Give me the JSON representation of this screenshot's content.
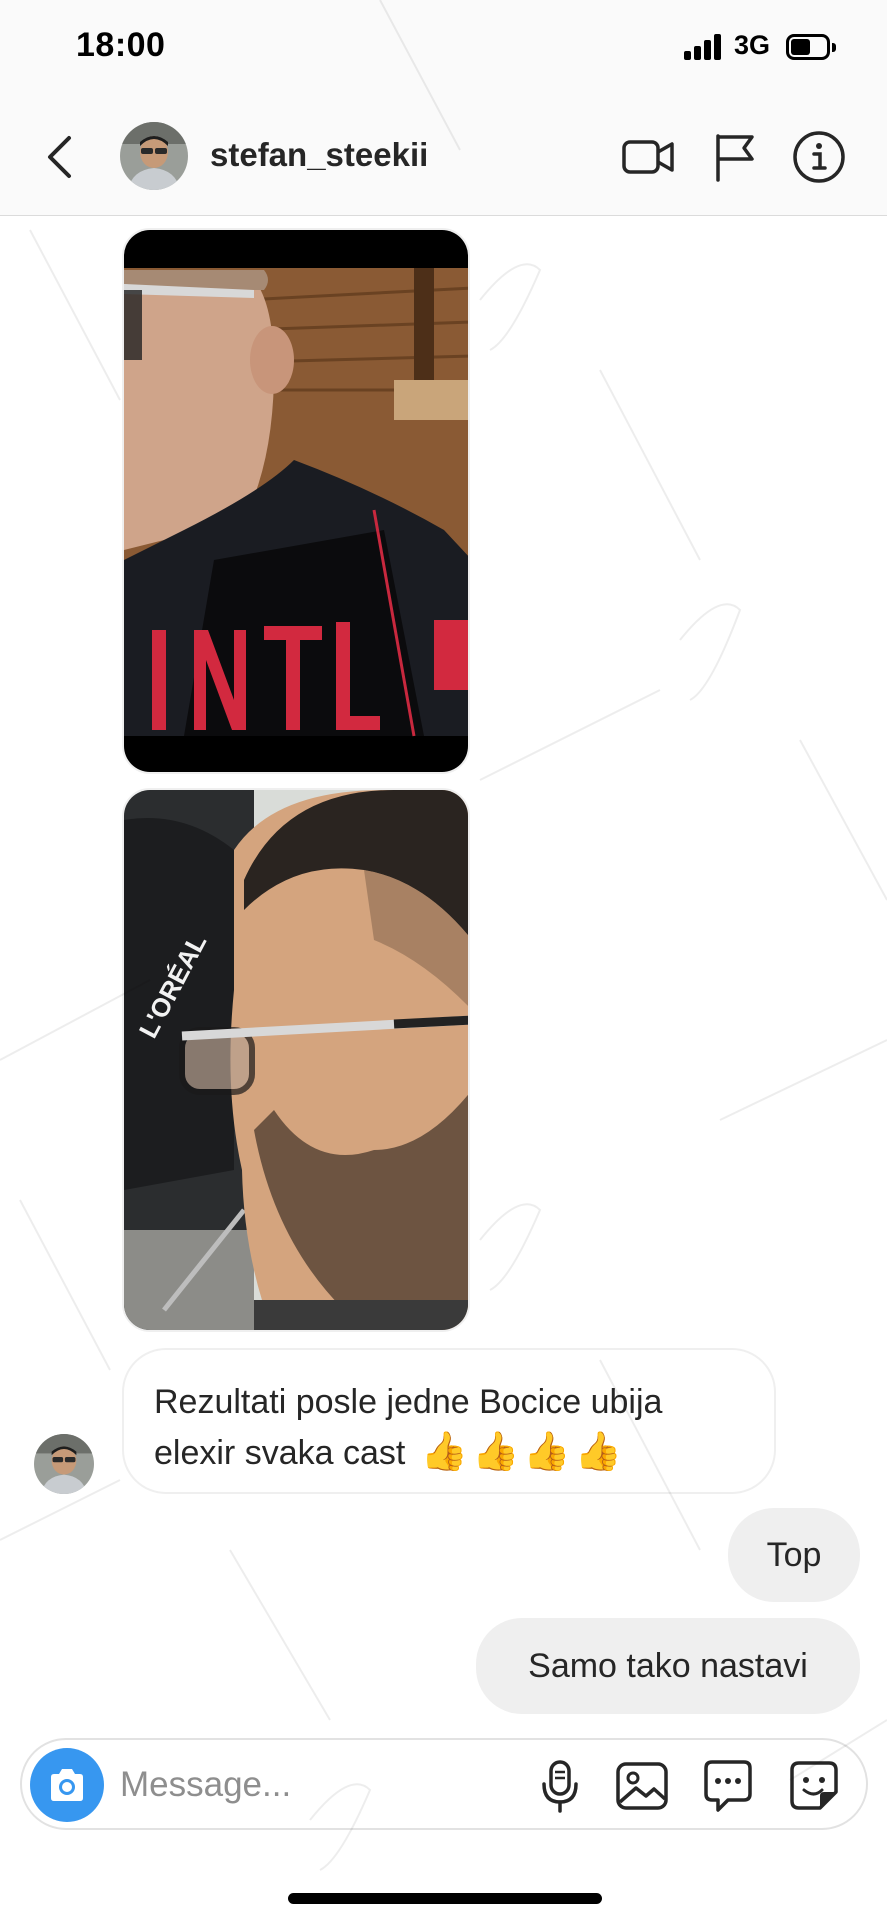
{
  "status_bar": {
    "time": "18:00",
    "network": "3G"
  },
  "header": {
    "username": "stefan_steekii"
  },
  "messages": {
    "received_text": {
      "line1": "Rezultati posle jedne Bocice ubija",
      "line2": "elexir svaka cast",
      "emoji": "👍👍👍👍"
    },
    "sent": [
      {
        "text": "Top"
      },
      {
        "text": "Samo tako nastavi"
      }
    ]
  },
  "composer": {
    "placeholder": "Message..."
  },
  "photo2": {
    "brand_text": "L'ORÉAL"
  },
  "icons": {
    "back": "chevron-left-icon",
    "video": "video-camera-icon",
    "report": "flag-icon",
    "info": "info-icon",
    "camera": "camera-icon",
    "mic": "microphone-icon",
    "gallery": "image-icon",
    "more": "chat-bubble-icon",
    "sticker": "sticker-icon"
  },
  "colors": {
    "accent": "#3797f0",
    "sent_bubble": "#efefef",
    "text": "#262626",
    "placeholder": "#8e8e8e"
  }
}
